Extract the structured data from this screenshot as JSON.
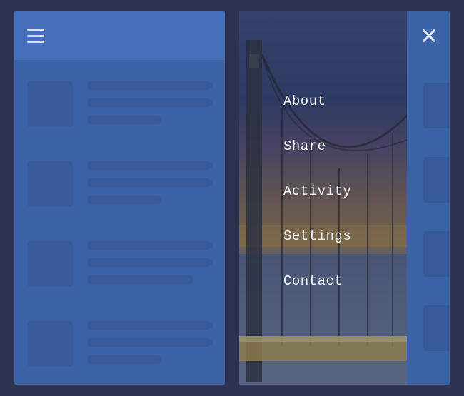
{
  "menu": {
    "items": [
      {
        "label": "About"
      },
      {
        "label": "Share"
      },
      {
        "label": "Activity"
      },
      {
        "label": "Settings"
      },
      {
        "label": "Contact"
      }
    ]
  },
  "icons": {
    "hamburger": "menu-icon",
    "close": "close-icon"
  }
}
